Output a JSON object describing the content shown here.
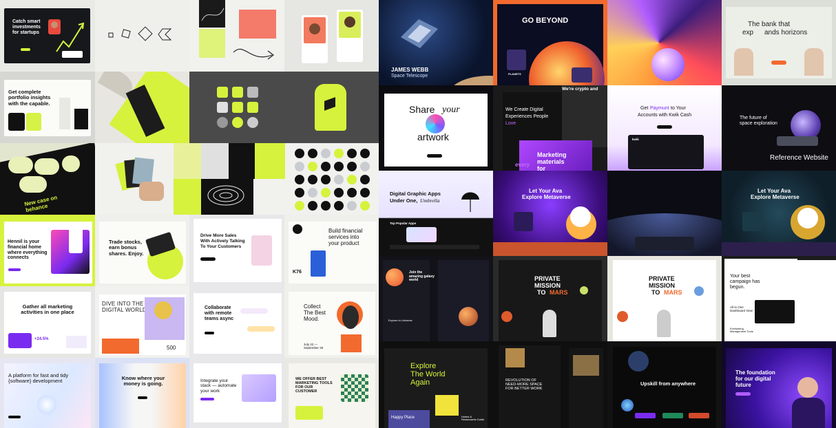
{
  "tiles": {
    "catch": "Catch smart investments for startups",
    "capable": "Get complete portfolio insights with the capable.",
    "behance": "New case on behance",
    "hennil": "Hennil is your financial home where everything connects",
    "trade": "Trade stocks, earn bonus shares. Enjoy.",
    "sales1": "Drive More Sales",
    "sales2": "With Actively Talking",
    "sales3": "To Your Customers",
    "build": "Build financial services into your product",
    "k76": "K76",
    "gather": "Gather all marketing activities in one place",
    "stat": "+24.5%",
    "dive": "DIVE INTO THE DIGITAL WORLD",
    "num500": "500",
    "collab1": "Collaborate",
    "collab2": "with remote",
    "collab3": "teams async",
    "collect": "Collect The Best Mood.",
    "sept": "July 22 — September 30",
    "platform": "A platform for fast and tidy {software} development",
    "money": "Know where your money is going.",
    "integrate": "Integrate your stack — automate your work",
    "marketing": "WE OFFER BEST MARKETING TOOLS FOR OUR CUSTOMER",
    "webb1": "JAMES WEBB",
    "webb2": "Space Telescope",
    "beyond": "GO BEYOND",
    "planets": "PLANETS",
    "bank1": "The bank that",
    "bank2": "exp",
    "bank3": "ands horizons",
    "share1": "Share",
    "share2": "your",
    "share3": "artwork",
    "digital1": "We Create Digital",
    "digital2": "Experiences People",
    "digital3": "Love",
    "crypto": "We're crypto and",
    "market1": "Marketing",
    "market2": "materials",
    "market3": "for",
    "every": "every",
    "kwik1": "Get",
    "kwik2": "Paymunt",
    "kwik3": "to Your",
    "kwik4": "Accounts with Kwik Cash",
    "kwik": "kwik",
    "future": "The future of space exploration",
    "ref": "Reference Website",
    "dga1": "Digital Graphic Apps",
    "dga2": "Under One,",
    "dga3": "Umbrella",
    "popular": "Top Popular Apps",
    "ava1": "Let Your Ava",
    "ava2": "Explore Metaverse",
    "galaxy": "Join the amazing galaxy world",
    "explore": "Explore in Universe",
    "mission1": "PRIVATE",
    "mission2": "MISSION",
    "mission3": "TO",
    "mission4": "MARS",
    "campaign": "Your best campaign has begun.",
    "allin": "All-in One Dashboard View",
    "everlasting": "Everlasting Management Tools",
    "world1": "Explore",
    "world2": "The World",
    "world3": "Again",
    "happy": "Happy Place",
    "hotel": "Hotels & Restaurants Guide",
    "revo": "REVOLUTION OF NEED-MORE SPACE FOR BETTER WORK",
    "upskill": "Upskill from anywhere",
    "foundation": "The foundation for our digital future"
  },
  "colors": {
    "lime": "#D8F23C",
    "coral": "#F47A6A",
    "purple": "#7A2BF0",
    "dark": "#0E0F14",
    "orange": "#F26A2E"
  }
}
